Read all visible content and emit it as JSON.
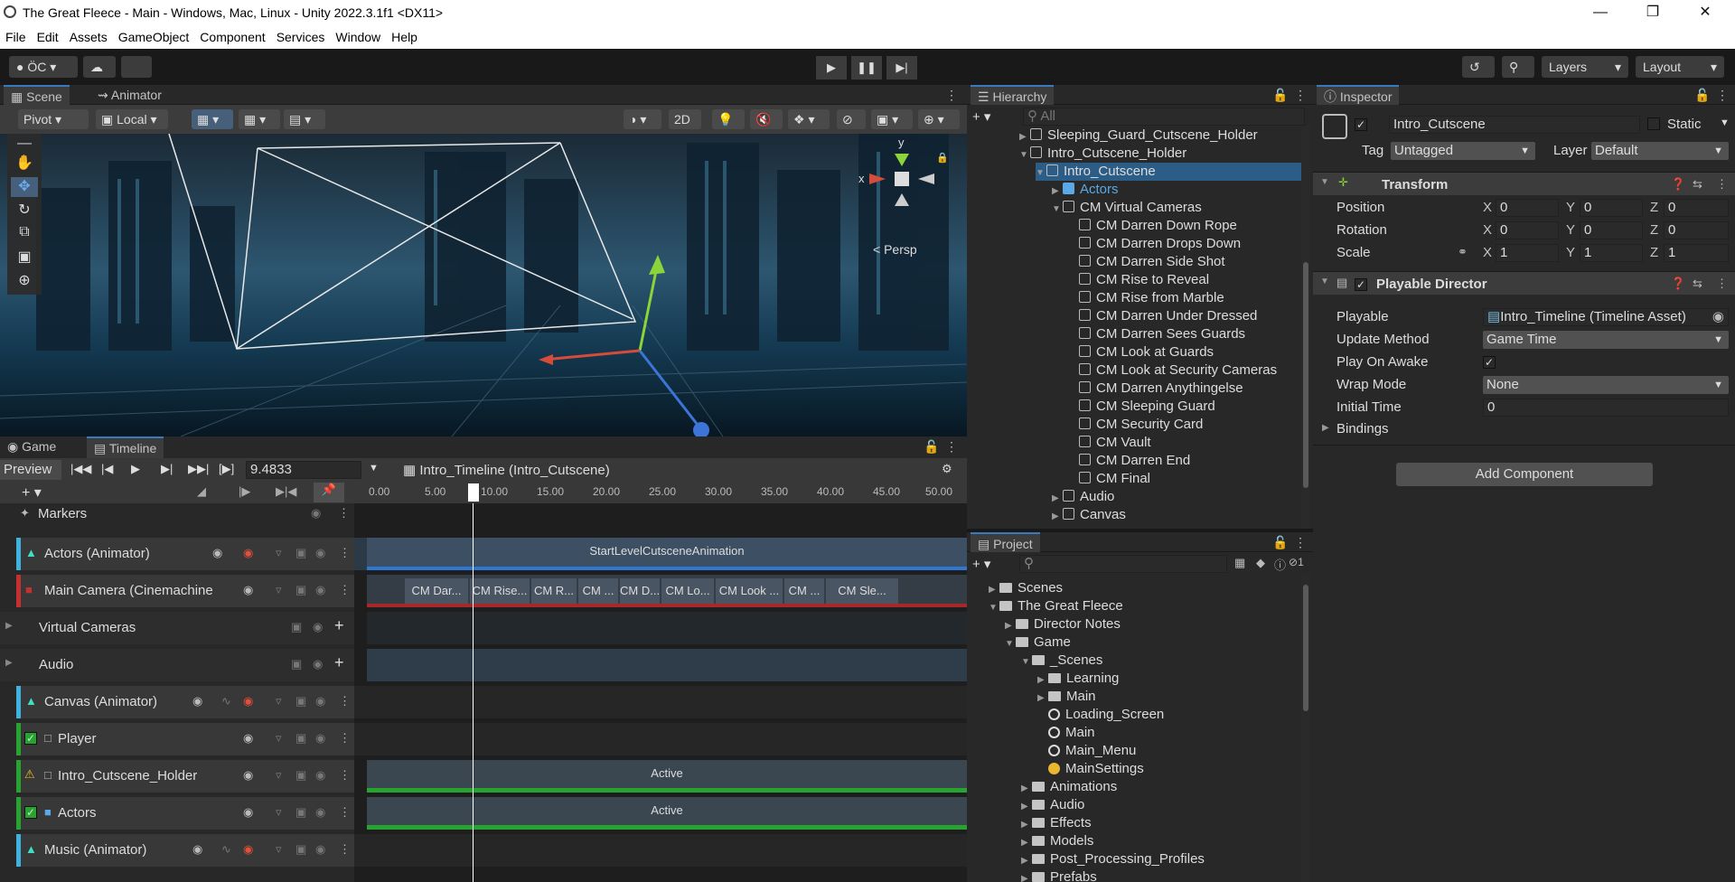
{
  "window": {
    "title": "The Great Fleece - Main - Windows, Mac, Linux - Unity 2022.3.1f1 <DX11>"
  },
  "menu": [
    "File",
    "Edit",
    "Assets",
    "GameObject",
    "Component",
    "Services",
    "Window",
    "Help"
  ],
  "toolbar": {
    "account": "ÖC",
    "layers": "Layers",
    "layout": "Layout"
  },
  "scene": {
    "tabs": [
      "Scene",
      "Animator"
    ],
    "pivot": "Pivot",
    "local": "Local",
    "mode2d": "2D",
    "persp": "< Persp",
    "gizmo_y": "y",
    "gizmo_x": "x"
  },
  "timeline": {
    "tabs": [
      "Game",
      "Timeline"
    ],
    "preview": "Preview",
    "time": "9.4833",
    "asset": "Intro_Timeline (Intro_Cutscene)",
    "ruler": [
      "0.00",
      "5.00",
      "10.00",
      "15.00",
      "20.00",
      "25.00",
      "30.00",
      "35.00",
      "40.00",
      "45.00",
      "50.00"
    ],
    "markers_label": "Markers",
    "tracks": [
      {
        "name": "Actors (Animator)",
        "clip": "StartLevelCutsceneAnimation"
      },
      {
        "name": "Main Camera (Cinemachine"
      },
      {
        "name": "Virtual Cameras"
      },
      {
        "name": "Audio"
      },
      {
        "name": "Canvas (Animator)"
      },
      {
        "name": "Player"
      },
      {
        "name": "Intro_Cutscene_Holder",
        "clip": "Active"
      },
      {
        "name": "Actors",
        "clip": "Active"
      },
      {
        "name": "Music (Animator)"
      }
    ],
    "camera_clips": [
      "CM Dar...",
      "CM Rise...",
      "CM R...",
      "CM ...",
      "CM D...",
      "CM Lo...",
      "CM Look ...",
      "CM ...",
      "CM Sle..."
    ]
  },
  "hierarchy": {
    "title": "Hierarchy",
    "search_placeholder": "All",
    "items": [
      {
        "label": "Sleeping_Guard_Cutscene_Holder"
      },
      {
        "label": "Intro_Cutscene_Holder"
      },
      {
        "label": "Intro_Cutscene"
      },
      {
        "label": "Actors"
      },
      {
        "label": "CM Virtual Cameras"
      },
      {
        "label": "CM Darren Down Rope"
      },
      {
        "label": "CM Darren Drops Down"
      },
      {
        "label": "CM Darren Side Shot"
      },
      {
        "label": "CM Rise to Reveal"
      },
      {
        "label": "CM Rise from Marble"
      },
      {
        "label": "CM Darren Under Dressed"
      },
      {
        "label": "CM Darren Sees Guards"
      },
      {
        "label": "CM Look at Guards"
      },
      {
        "label": "CM Look at Security Cameras"
      },
      {
        "label": "CM Darren Anythingelse"
      },
      {
        "label": "CM Sleeping Guard"
      },
      {
        "label": "CM Security Card"
      },
      {
        "label": "CM Vault"
      },
      {
        "label": "CM Darren End"
      },
      {
        "label": "CM Final"
      },
      {
        "label": "Audio"
      },
      {
        "label": "Canvas"
      }
    ]
  },
  "project": {
    "title": "Project",
    "hidden_count": "1",
    "items": [
      {
        "label": "Scenes"
      },
      {
        "label": "The Great Fleece"
      },
      {
        "label": "Director Notes"
      },
      {
        "label": "Game"
      },
      {
        "label": "_Scenes"
      },
      {
        "label": "Learning"
      },
      {
        "label": "Main"
      },
      {
        "label": "Loading_Screen"
      },
      {
        "label": "Main"
      },
      {
        "label": "Main_Menu"
      },
      {
        "label": "MainSettings"
      },
      {
        "label": "Animations"
      },
      {
        "label": "Audio"
      },
      {
        "label": "Effects"
      },
      {
        "label": "Models"
      },
      {
        "label": "Post_Processing_Profiles"
      },
      {
        "label": "Prefabs"
      }
    ]
  },
  "inspector": {
    "title": "Inspector",
    "object_name": "Intro_Cutscene",
    "static": "Static",
    "tag_label": "Tag",
    "tag": "Untagged",
    "layer_label": "Layer",
    "layer": "Default",
    "transform": {
      "title": "Transform",
      "position_label": "Position",
      "rotation_label": "Rotation",
      "scale_label": "Scale",
      "position": [
        "0",
        "0",
        "0"
      ],
      "rotation": [
        "0",
        "0",
        "0"
      ],
      "scale": [
        "1",
        "1",
        "1"
      ],
      "axes": [
        "X",
        "Y",
        "Z"
      ]
    },
    "director": {
      "title": "Playable Director",
      "playable_label": "Playable",
      "playable": "Intro_Timeline (Timeline Asset)",
      "update_label": "Update Method",
      "update": "Game Time",
      "awake_label": "Play On Awake",
      "wrap_label": "Wrap Mode",
      "wrap": "None",
      "initial_label": "Initial Time",
      "initial": "0",
      "bindings_label": "Bindings"
    },
    "add_component": "Add Component"
  }
}
